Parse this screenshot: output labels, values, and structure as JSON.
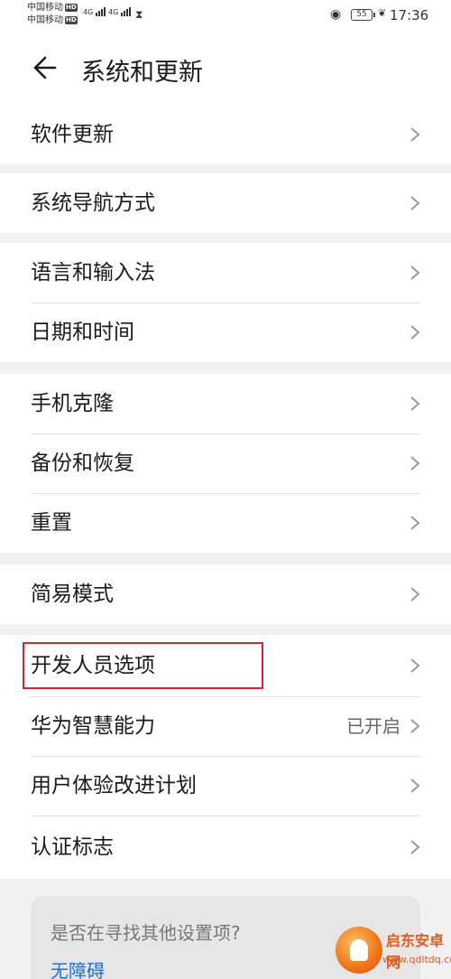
{
  "status_bar": {
    "carrier_1": "中国移动",
    "carrier_2": "中国移动",
    "hd_badge": "HD",
    "network_1": "4G",
    "network_2": "4G",
    "battery": "55",
    "time": "17:36",
    "icons": [
      "signal-icon",
      "hourglass-icon",
      "eye-icon",
      "battery-icon",
      "leaf-icon"
    ]
  },
  "header": {
    "title": "系统和更新",
    "back_icon": "arrow-left-icon"
  },
  "groups": [
    {
      "items": [
        {
          "label": "软件更新"
        }
      ]
    },
    {
      "items": [
        {
          "label": "系统导航方式"
        }
      ]
    },
    {
      "items": [
        {
          "label": "语言和输入法"
        },
        {
          "label": "日期和时间"
        }
      ]
    },
    {
      "items": [
        {
          "label": "手机克隆"
        },
        {
          "label": "备份和恢复"
        },
        {
          "label": "重置"
        }
      ]
    },
    {
      "items": [
        {
          "label": "简易模式"
        }
      ]
    },
    {
      "items": [
        {
          "label": "开发人员选项",
          "highlighted": true
        },
        {
          "label": "华为智慧能力",
          "value": "已开启"
        },
        {
          "label": "用户体验改进计划"
        },
        {
          "label": "认证标志"
        }
      ]
    }
  ],
  "suggestions": {
    "title": "是否在寻找其他设置项?",
    "link": "无障碍"
  },
  "watermark": {
    "name": "启东安卓网",
    "url": "www.qdltdq.com"
  },
  "colors": {
    "highlight": "#d9252b",
    "link": "#1f6fd6",
    "background": "#f1f1f1"
  }
}
